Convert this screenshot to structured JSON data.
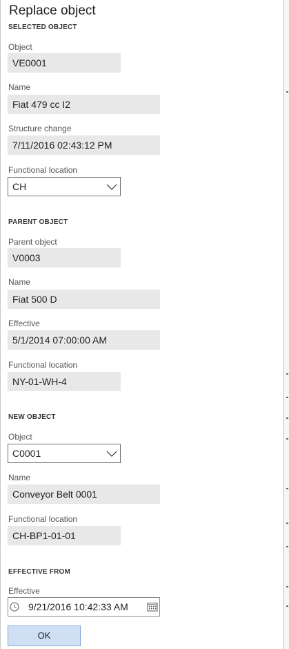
{
  "dialog": {
    "title": "Replace object"
  },
  "selected_object": {
    "heading": "SELECTED OBJECT",
    "object_label": "Object",
    "object_value": "VE0001",
    "name_label": "Name",
    "name_value": "Fiat 479 cc I2",
    "structure_change_label": "Structure change",
    "structure_change_value": "7/11/2016 02:43:12 PM",
    "functional_location_label": "Functional location",
    "functional_location_value": "CH"
  },
  "parent_object": {
    "heading": "PARENT OBJECT",
    "parent_label": "Parent object",
    "parent_value": "V0003",
    "name_label": "Name",
    "name_value": "Fiat 500 D",
    "effective_label": "Effective",
    "effective_value": "5/1/2014 07:00:00 AM",
    "functional_location_label": "Functional location",
    "functional_location_value": "NY-01-WH-4"
  },
  "new_object": {
    "heading": "NEW OBJECT",
    "object_label": "Object",
    "object_value": "C0001",
    "name_label": "Name",
    "name_value": "Conveyor Belt 0001",
    "functional_location_label": "Functional location",
    "functional_location_value": "CH-BP1-01-01"
  },
  "effective_from": {
    "heading": "EFFECTIVE FROM",
    "effective_label": "Effective",
    "effective_value": "9/21/2016 10:42:33 AM"
  },
  "actions": {
    "ok_label": "OK"
  },
  "icons": {
    "dropdown": "chevron-down-icon",
    "clock": "clock-icon",
    "calendar": "calendar-icon"
  },
  "colors": {
    "readonly_bg": "#e8e8e8",
    "ok_bg": "#cfe0f4",
    "ok_border": "#7ea6d8"
  }
}
